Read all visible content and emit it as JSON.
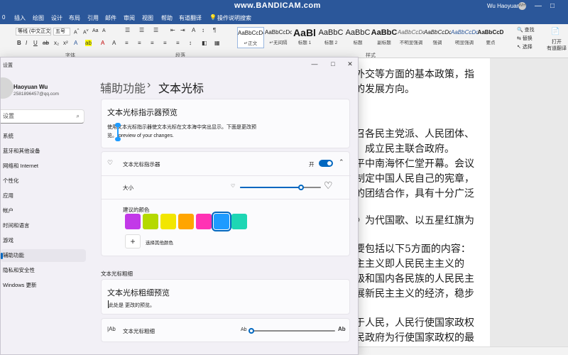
{
  "word": {
    "tabs": [
      "插入",
      "绘图",
      "设计",
      "布局",
      "引用",
      "邮件",
      "审阅",
      "视图",
      "帮助",
      "有道翻译",
      "操作说明搜索"
    ],
    "watermark": "www.BANDICAM.com",
    "user": "Wu Haoyuan",
    "avatar_initials": "WH",
    "font_name": "等线 (中文正文)",
    "font_size": "五号",
    "groups": {
      "font": "字体",
      "paragraph": "段落",
      "styles": "样式"
    },
    "styles": [
      {
        "preview": "AaBbCcDc",
        "label": "↵正文"
      },
      {
        "preview": "AaBbCcDc",
        "label": "↵无间隔"
      },
      {
        "preview": "AaBl",
        "label": "标题 1"
      },
      {
        "preview": "AaBbC",
        "label": "标题 2"
      },
      {
        "preview": "AaBbC",
        "label": "标题"
      },
      {
        "preview": "AaBbC",
        "label": "副标题"
      },
      {
        "preview": "AaBbCcDc",
        "label": "不明显强调"
      },
      {
        "preview": "AaBbCcDc",
        "label": "强调"
      },
      {
        "preview": "AaBbCcDc",
        "label": "明显强调"
      },
      {
        "preview": "AaBbCcD",
        "label": "要点"
      }
    ],
    "editing": {
      "find": "查找",
      "replace": "替换",
      "select": "选择"
    },
    "translate": {
      "open": "打开",
      "label": "有道翻译"
    },
    "left_clip": "0",
    "doc_lines": [
      "外交等方面的基本政策，指",
      "的发展方向。",
      "",
      "召各民主党派、人民团体、",
      "、成立民主联合政府。",
      "平中南海怀仁堂开幕。会议",
      "制定中国人民自己的宪章，",
      "的团结合作，具有十分广泛",
      "",
      "》为代国歌、以五星红旗为",
      "",
      "要包括以下5方面的内容：",
      "主主义即人民民主主义的",
      "级和国内各民族的人民民主",
      "展新民主主义的经济，稳步",
      "",
      "于人民，人民行使国家政权",
      "民政府为行使国家政权的最"
    ]
  },
  "settings": {
    "window_title": "设置",
    "controls": {
      "minimize": "—",
      "maximize": "□",
      "close": "✕"
    },
    "profile": {
      "name": "Haoyuan Wu",
      "email": "2581896457@qq.com"
    },
    "search_placeholder": "设置",
    "nav": [
      "系统",
      "蓝牙和其他设备",
      "网络和 Internet",
      "个性化",
      "应用",
      "帐户",
      "时间和语言",
      "游戏",
      "辅助功能",
      "隐私和安全性",
      "Windows 更新"
    ],
    "active_nav_index": 8,
    "breadcrumb": {
      "parent": "辅助功能",
      "separator": "›",
      "current": "文本光标"
    },
    "indicator_preview": {
      "title": "文本光标指示器预览",
      "text1": "使用文本光标指示器使文本光标在文本海中突出显示。下面是更改预",
      "text2": "览。 preview of your changes."
    },
    "indicator": {
      "label": "文本光标指示器",
      "state": "开",
      "size_label": "大小",
      "size_level": 0.75,
      "colors_label": "建议的颜色",
      "colors": [
        "#c239e8",
        "#b5d900",
        "#f2e600",
        "#ffa500",
        "#ff32b4",
        "#1e9bff",
        "#1ed6b4"
      ],
      "selected_color_index": 5,
      "other_color": "选择其他颜色"
    },
    "thickness": {
      "section": "文本光标粗细",
      "preview_title": "文本光标粗细预览",
      "preview_text": "此处是 更改的预览。",
      "label": "文本光标粗细",
      "icon_left": "Ab",
      "icon_right": "Ab",
      "level": 0.0
    }
  }
}
